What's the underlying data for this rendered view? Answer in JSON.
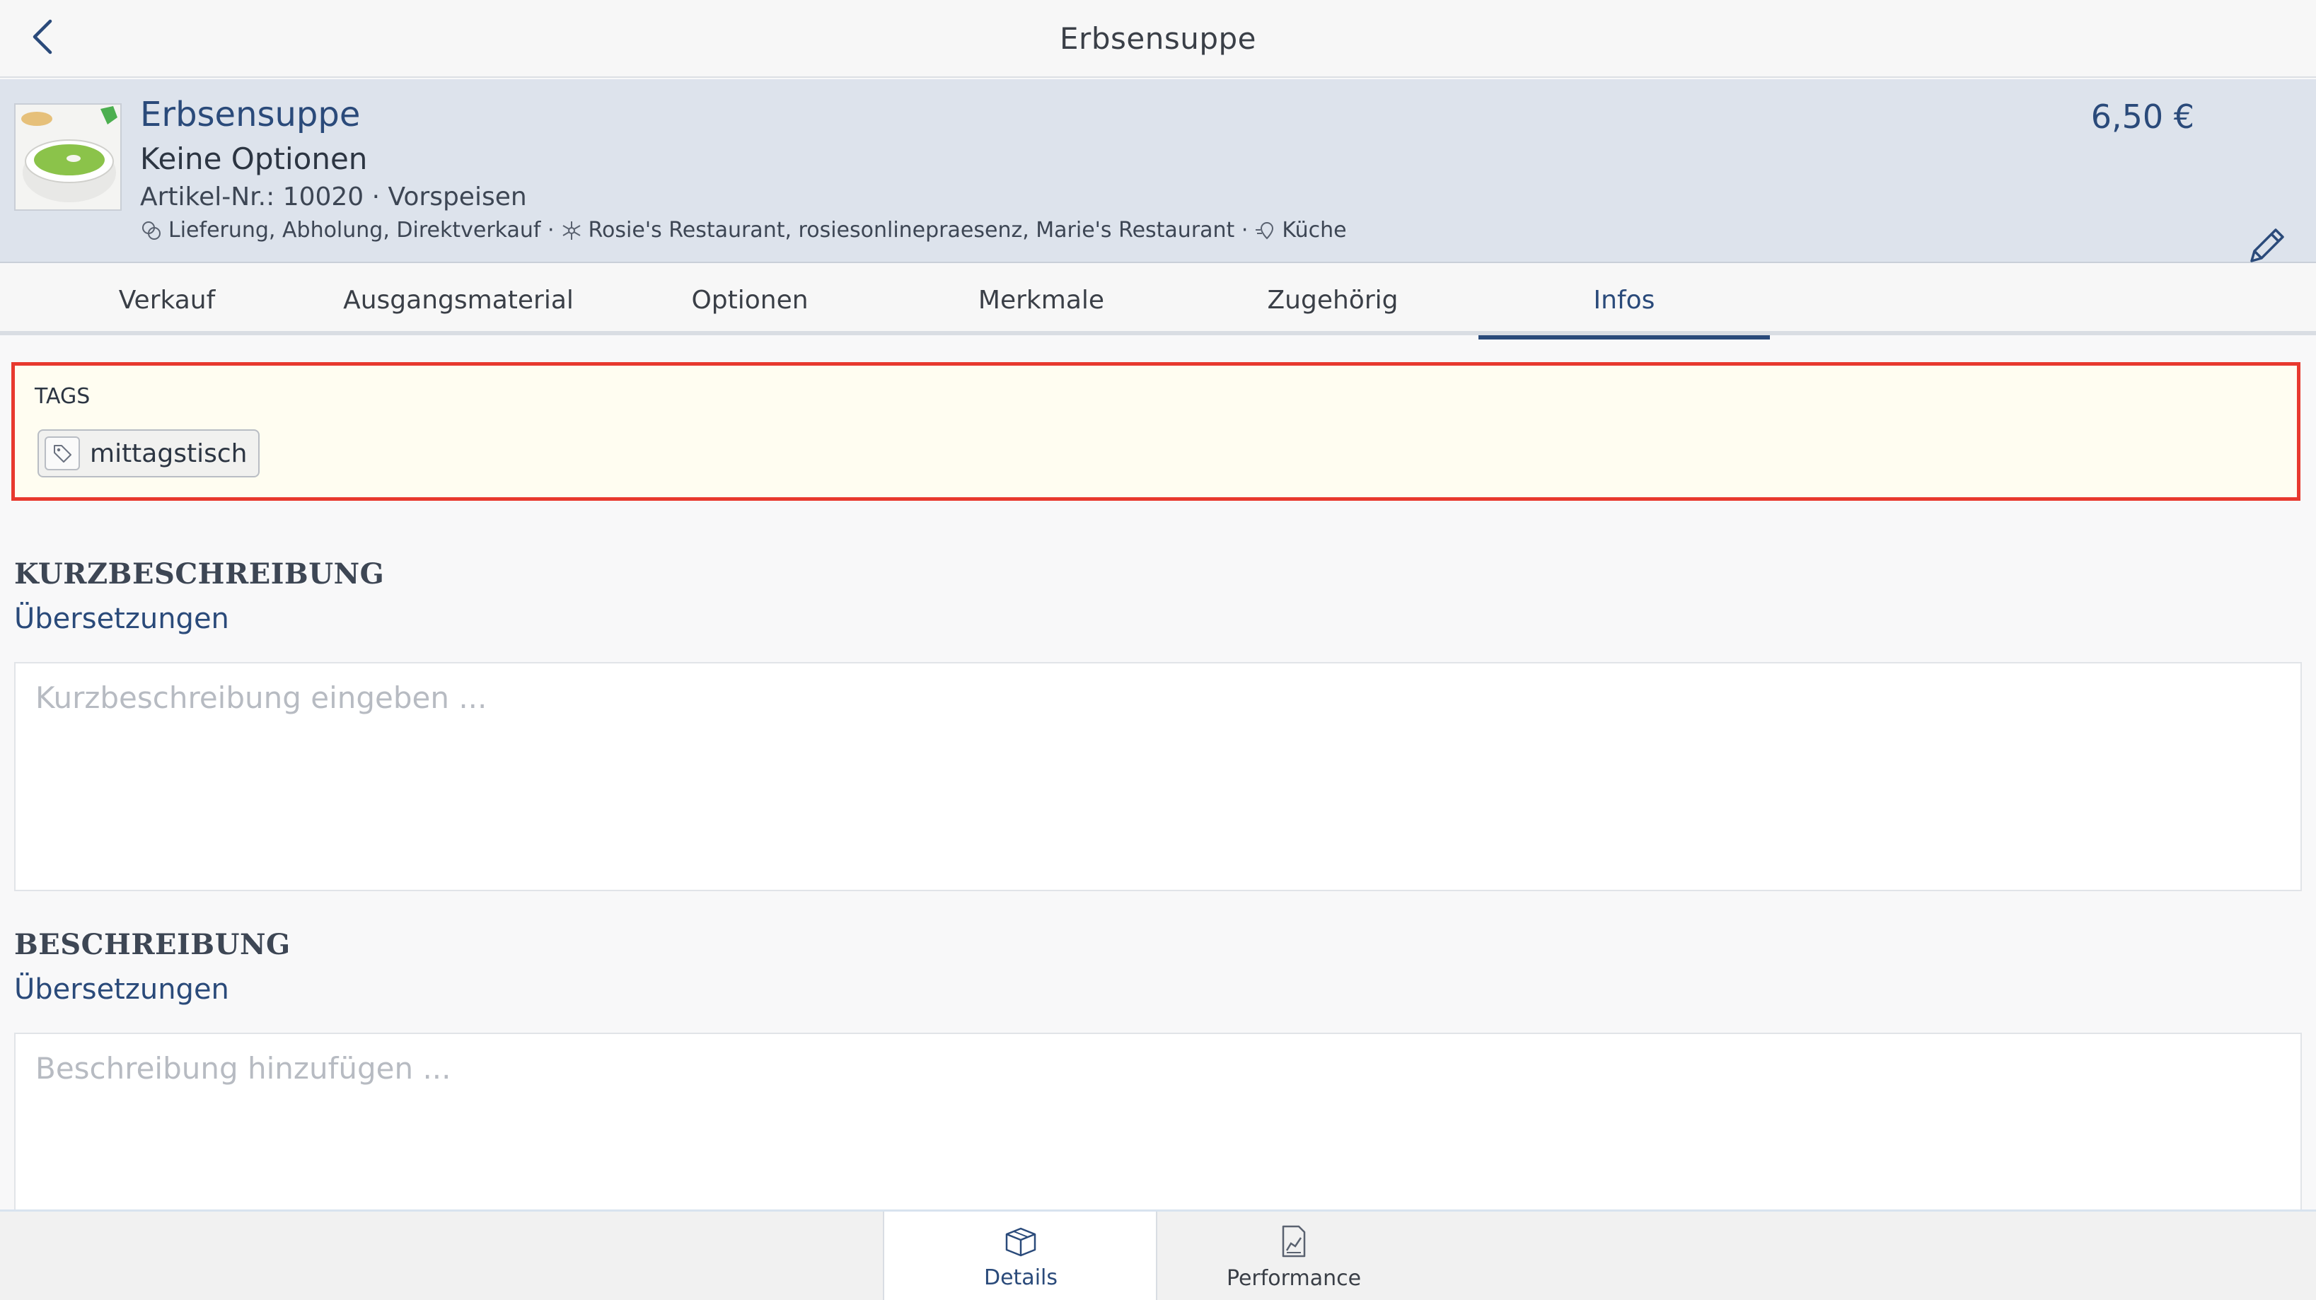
{
  "nav": {
    "title": "Erbsensuppe"
  },
  "product": {
    "name": "Erbsensuppe",
    "options": "Keine Optionen",
    "meta": "Artikel-Nr.: 10020 · Vorspeisen",
    "delivery": "Lieferung, Abholung, Direktverkauf ·",
    "stores": "Rosie's Restaurant, rosiesonlinepraesenz, Marie's Restaurant ·",
    "kitchen": "Küche",
    "price": "6,50 €"
  },
  "tabs": [
    {
      "label": "Verkauf"
    },
    {
      "label": "Ausgangsmaterial"
    },
    {
      "label": "Optionen"
    },
    {
      "label": "Merkmale"
    },
    {
      "label": "Zugehörig"
    },
    {
      "label": "Infos",
      "active": true
    }
  ],
  "tags": {
    "label": "TAGS",
    "items": [
      "mittagstisch"
    ]
  },
  "short_description": {
    "title": "KURZBESCHREIBUNG",
    "link": "Übersetzungen",
    "placeholder": "Kurzbeschreibung eingeben ..."
  },
  "description": {
    "title": "BESCHREIBUNG",
    "link": "Übersetzungen",
    "placeholder": "Beschreibung hinzufügen ..."
  },
  "bottom_tabs": [
    {
      "label": "Details",
      "icon": "box-icon",
      "active": true
    },
    {
      "label": "Performance",
      "icon": "chart-document-icon"
    }
  ],
  "colors": {
    "accent": "#2a4a7a",
    "highlight_border": "#e8392e",
    "highlight_bg": "#fffdf1"
  }
}
